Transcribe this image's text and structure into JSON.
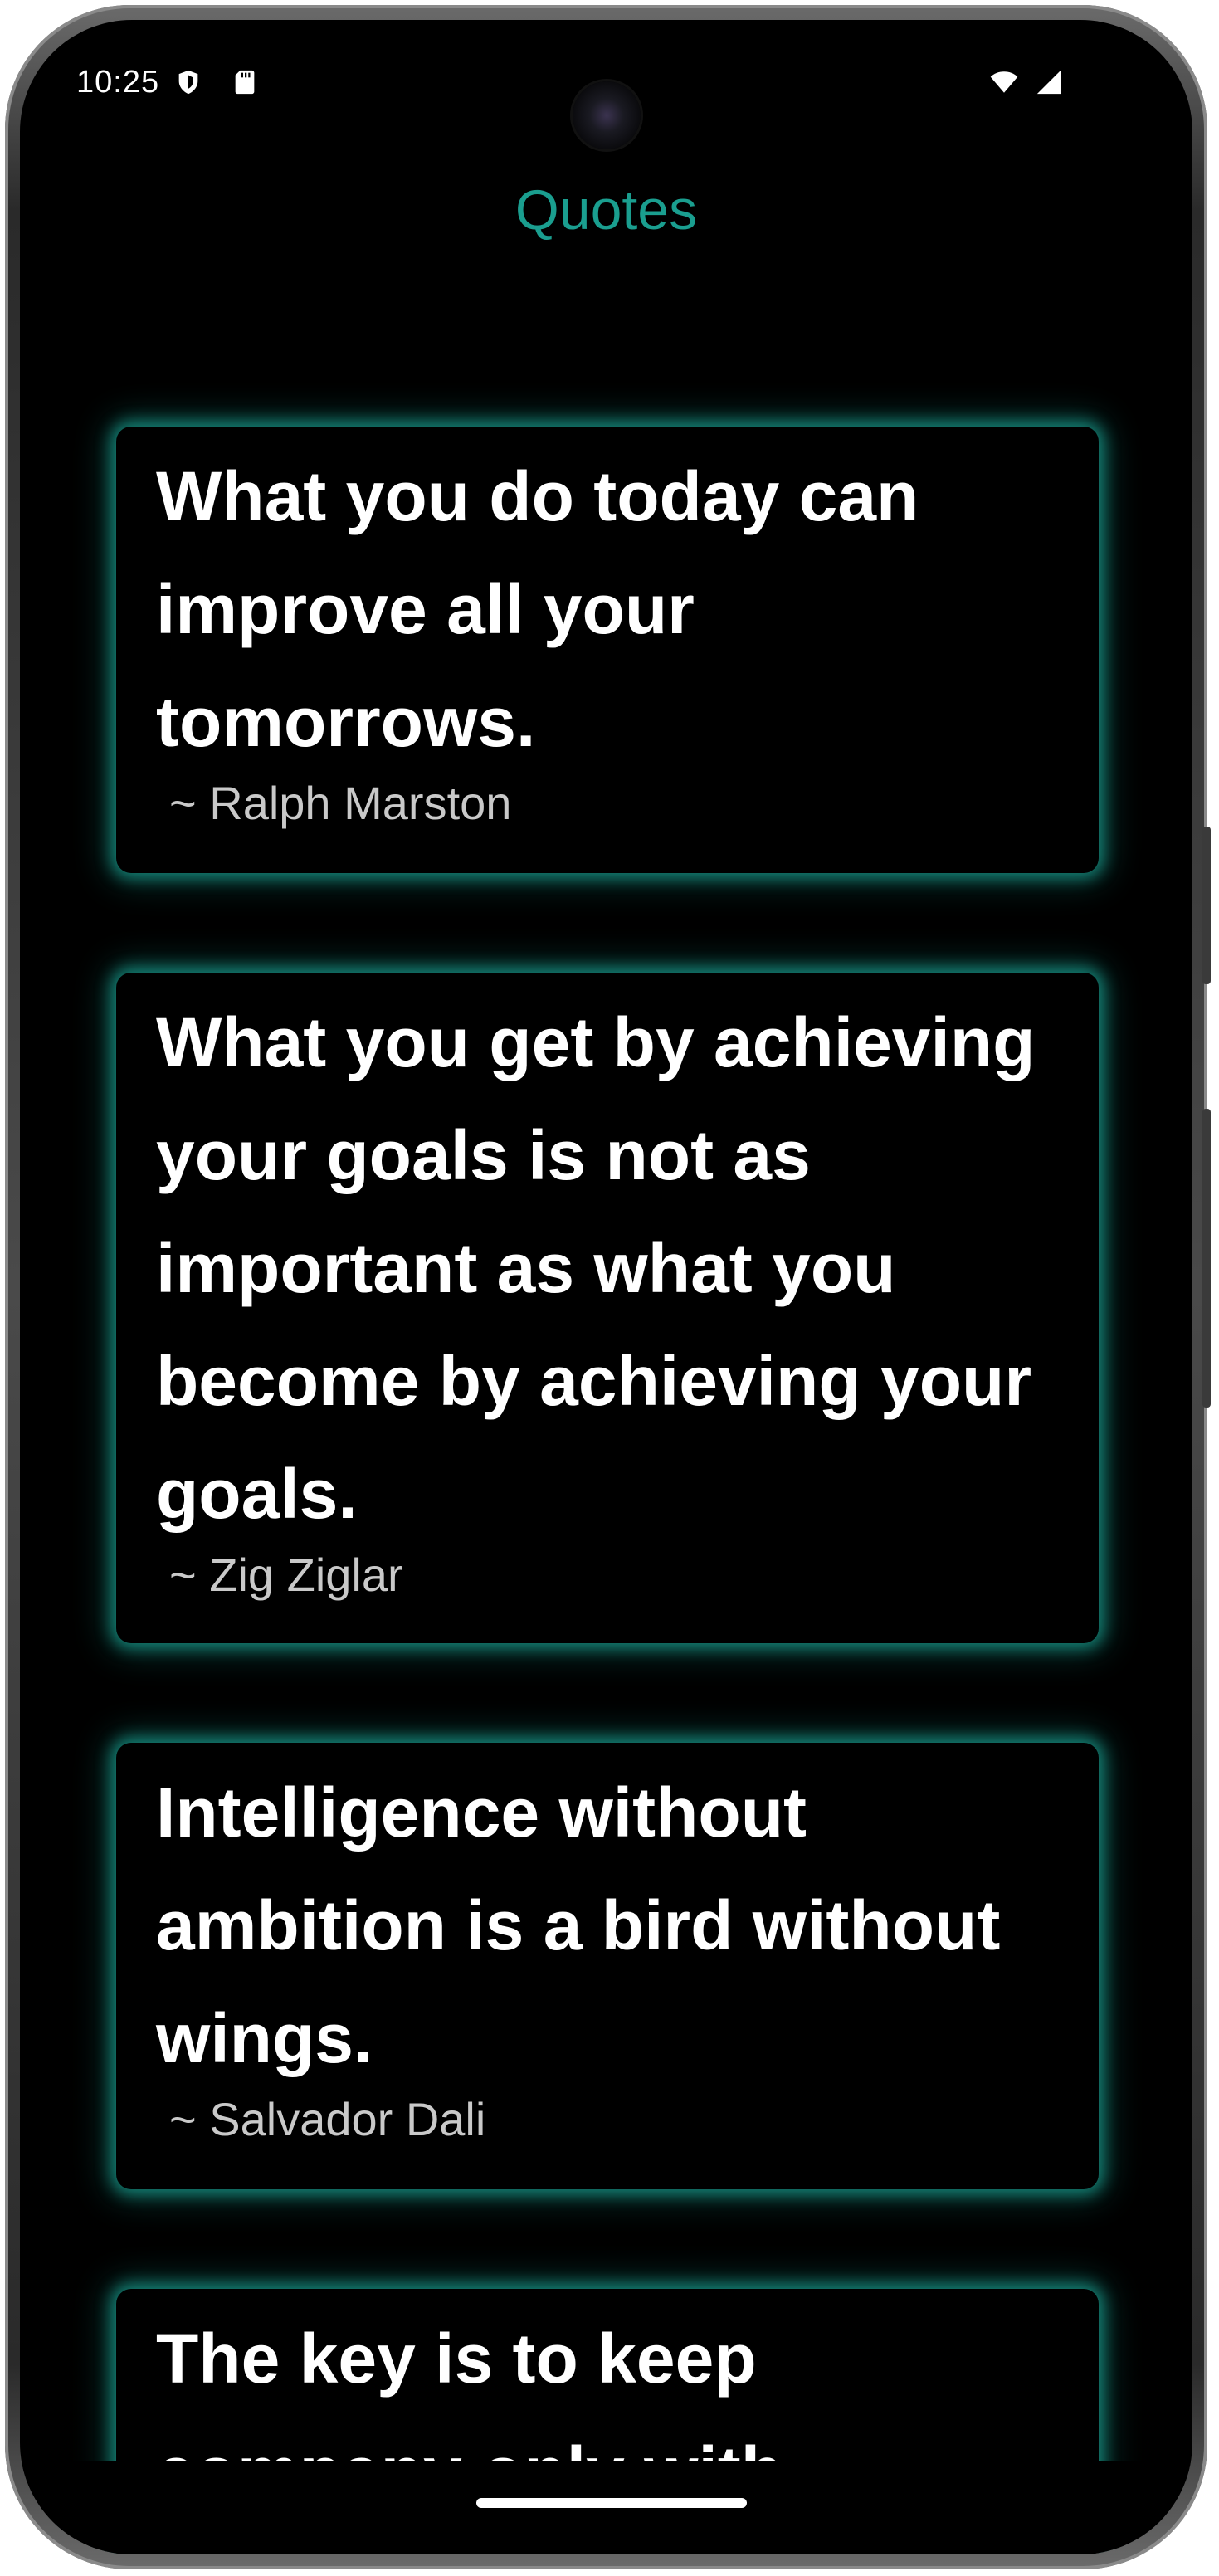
{
  "status_bar": {
    "time": "10:25",
    "left_icons": [
      "shield-icon",
      "sd-card-icon"
    ],
    "right_icons": [
      "wifi-icon",
      "signal-icon"
    ]
  },
  "app": {
    "title": "Quotes",
    "accent_color": "#1a9e8f"
  },
  "quotes": [
    {
      "text": "What you do today can improve all your tomorrows.",
      "author": "~ Ralph Marston"
    },
    {
      "text": "What you get by achieving your goals is not as important as what you become by achieving your goals.",
      "author": "~ Zig Ziglar"
    },
    {
      "text": "Intelligence without ambition is a bird without wings.",
      "author": "~ Salvador Dali"
    },
    {
      "text": "The key is to keep company only with",
      "author": ""
    }
  ]
}
